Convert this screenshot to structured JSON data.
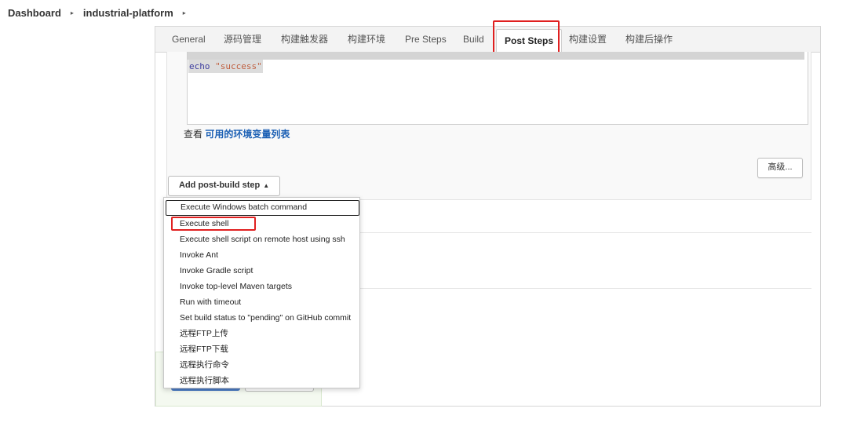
{
  "breadcrumb": {
    "items": [
      "Dashboard",
      "industrial-platform"
    ],
    "separator": "▸"
  },
  "tabs": [
    {
      "label": "General"
    },
    {
      "label": "源码管理"
    },
    {
      "label": "构建触发器"
    },
    {
      "label": "构建环境"
    },
    {
      "label": "Pre Steps"
    },
    {
      "label": "Build"
    },
    {
      "label": "Post Steps",
      "active": true
    },
    {
      "label": "构建设置"
    },
    {
      "label": "构建后操作"
    }
  ],
  "editor": {
    "keyword": "echo",
    "string": "\"success\""
  },
  "env_vars": {
    "prefix": "查看",
    "link": "可用的环境变量列表"
  },
  "advanced_button": "高级...",
  "add_step_button": {
    "label": "Add post-build step",
    "caret": "▲"
  },
  "dropdown": {
    "items": [
      "Execute Windows batch command",
      "Execute shell",
      "Execute shell script on remote host using ssh",
      "Invoke Ant",
      "Invoke Gradle script",
      "Invoke top-level Maven targets",
      "Run with timeout",
      "Set build status to \"pending\" on GitHub commit",
      "远程FTP上传",
      "远程FTP下载",
      "远程执行命令",
      "远程执行脚本"
    ],
    "focused_index": 0,
    "highlighted_index": 1
  },
  "colors": {
    "highlight": "#e02020",
    "link": "#1a5fb4",
    "primary_button": "#4b7cc4"
  }
}
